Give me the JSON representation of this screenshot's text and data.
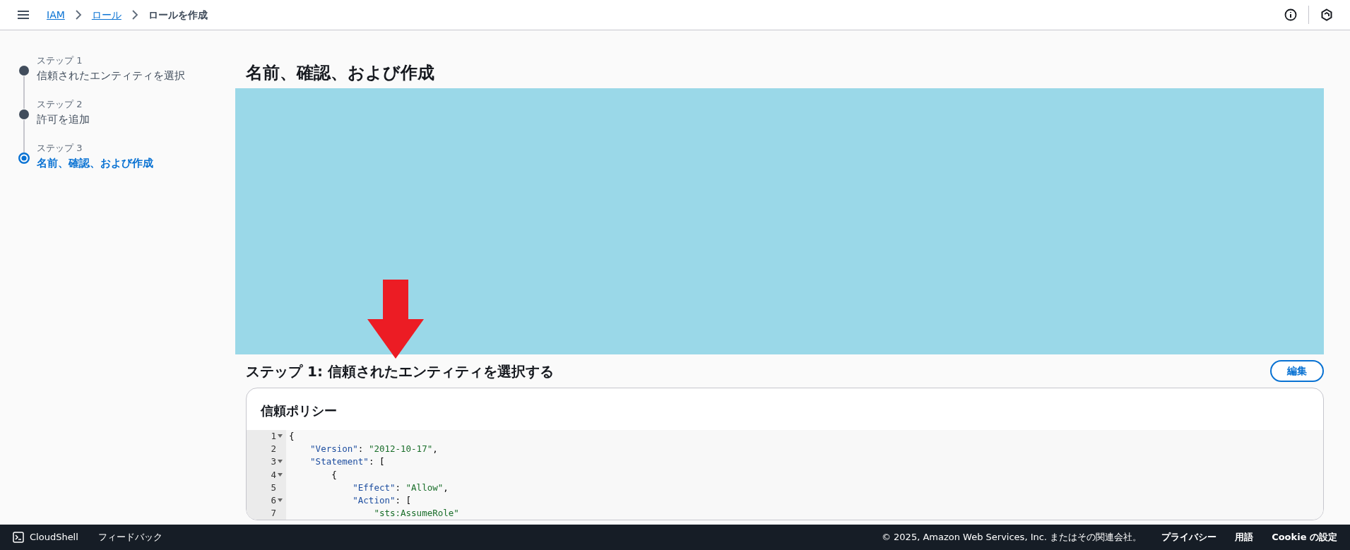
{
  "top_bar": {
    "breadcrumbs": [
      {
        "label": "IAM",
        "kind": "link"
      },
      {
        "label": "ロール",
        "kind": "link"
      },
      {
        "label": "ロールを作成",
        "kind": "current"
      }
    ]
  },
  "steps": [
    {
      "caption": "ステップ 1",
      "label": "信頼されたエンティティを選択",
      "selected": false
    },
    {
      "caption": "ステップ 2",
      "label": "許可を追加",
      "selected": false
    },
    {
      "caption": "ステップ 3",
      "label": "名前、確認、および作成",
      "selected": true
    }
  ],
  "page_title": "名前、確認、および作成",
  "section": {
    "title": "ステップ 1: 信頼されたエンティティを選択する",
    "edit_button": "編集",
    "card_title": "信頼ポリシー",
    "code_lines": [
      {
        "number": "1",
        "foldable": true,
        "tokens": [
          {
            "kind": "punct",
            "text": "{"
          }
        ],
        "children": [
          {
            "number": "2",
            "foldable": false,
            "tokens": [
              {
                "kind": "key",
                "text": "\"Version\""
              },
              {
                "kind": "punct",
                "text": ":"
              },
              {
                "kind": "string",
                "text": "\"2012-10-17\""
              },
              {
                "kind": "punct",
                "text": ","
              }
            ]
          },
          {
            "number": "3",
            "foldable": true,
            "tokens": [
              {
                "kind": "key",
                "text": "\"Statement\""
              },
              {
                "kind": "punct",
                "text": ":"
              },
              {
                "kind": "punct",
                "text": "["
              }
            ],
            "children": [
              {
                "number": "4",
                "foldable": true,
                "tokens": [
                  {
                    "kind": "punct",
                    "text": "{"
                  }
                ],
                "children": [
                  {
                    "number": "5",
                    "foldable": false,
                    "tokens": [
                      {
                        "kind": "key",
                        "text": "\"Effect\""
                      },
                      {
                        "kind": "punct",
                        "text": ":"
                      },
                      {
                        "kind": "string",
                        "text": "\"Allow\""
                      },
                      {
                        "kind": "punct",
                        "text": ","
                      }
                    ]
                  },
                  {
                    "number": "6",
                    "foldable": true,
                    "tokens": [
                      {
                        "kind": "key",
                        "text": "\"Action\""
                      },
                      {
                        "kind": "punct",
                        "text": ":"
                      },
                      {
                        "kind": "punct",
                        "text": "["
                      }
                    ],
                    "children": [
                      {
                        "number": "7",
                        "foldable": false,
                        "tokens": [
                          {
                            "kind": "string",
                            "text": "\"sts:AssumeRole\""
                          }
                        ]
                      }
                    ]
                  }
                ]
              }
            ]
          }
        ]
      }
    ]
  },
  "footer": {
    "left": [
      "CloudShell",
      "フィードバック"
    ],
    "copyright": "© 2025, Amazon Web Services, Inc. またはその関連会社。",
    "links": [
      "プライバシー",
      "用語",
      "Cookie の設定"
    ]
  }
}
